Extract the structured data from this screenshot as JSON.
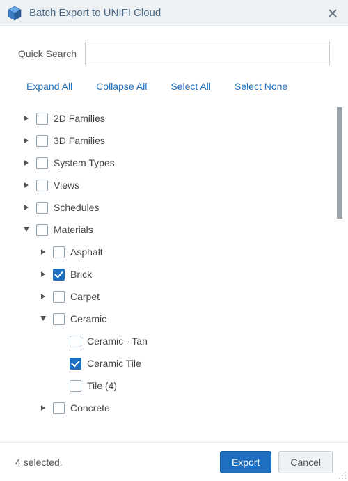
{
  "window": {
    "title": "Batch Export to UNIFI Cloud"
  },
  "search": {
    "label": "Quick Search",
    "value": "",
    "placeholder": ""
  },
  "actions": {
    "expand_all": "Expand All",
    "collapse_all": "Collapse All",
    "select_all": "Select All",
    "select_none": "Select None"
  },
  "tree": [
    {
      "label": "2D Families",
      "level": 0,
      "expanded": false,
      "checked": false,
      "hasChildren": true
    },
    {
      "label": "3D Families",
      "level": 0,
      "expanded": false,
      "checked": false,
      "hasChildren": true
    },
    {
      "label": "System Types",
      "level": 0,
      "expanded": false,
      "checked": false,
      "hasChildren": true
    },
    {
      "label": "Views",
      "level": 0,
      "expanded": false,
      "checked": false,
      "hasChildren": true
    },
    {
      "label": "Schedules",
      "level": 0,
      "expanded": false,
      "checked": false,
      "hasChildren": true
    },
    {
      "label": "Materials",
      "level": 0,
      "expanded": true,
      "checked": false,
      "hasChildren": true
    },
    {
      "label": "Asphalt",
      "level": 1,
      "expanded": false,
      "checked": false,
      "hasChildren": true
    },
    {
      "label": "Brick",
      "level": 1,
      "expanded": false,
      "checked": true,
      "hasChildren": true
    },
    {
      "label": "Carpet",
      "level": 1,
      "expanded": false,
      "checked": false,
      "hasChildren": true
    },
    {
      "label": "Ceramic",
      "level": 1,
      "expanded": true,
      "checked": false,
      "hasChildren": true
    },
    {
      "label": "Ceramic - Tan",
      "level": 2,
      "expanded": false,
      "checked": false,
      "hasChildren": false
    },
    {
      "label": "Ceramic Tile",
      "level": 2,
      "expanded": false,
      "checked": true,
      "hasChildren": false
    },
    {
      "label": "Tile (4)",
      "level": 2,
      "expanded": false,
      "checked": false,
      "hasChildren": false
    },
    {
      "label": "Concrete",
      "level": 1,
      "expanded": false,
      "checked": false,
      "hasChildren": true
    }
  ],
  "footer": {
    "status": "4 selected.",
    "export": "Export",
    "cancel": "Cancel"
  }
}
